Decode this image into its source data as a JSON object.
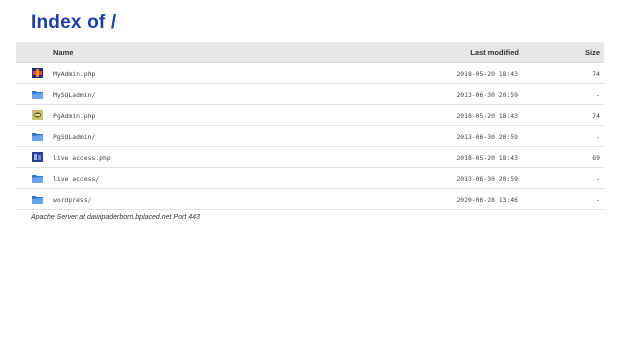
{
  "title": "Index of /",
  "headers": {
    "name": "Name",
    "modified": "Last modified",
    "size": "Size"
  },
  "rows": [
    {
      "name": "MyAdmin.php",
      "modified": "2018-05-20 18:43",
      "size": "74",
      "icon": "php-file-icon"
    },
    {
      "name": "MySQLadmin/",
      "modified": "2013-06-30 20:59",
      "size": "-",
      "icon": "folder-icon"
    },
    {
      "name": "PgAdmin.php",
      "modified": "2018-05-20 18:43",
      "size": "74",
      "icon": "php-file-icon"
    },
    {
      "name": "PgSQLadmin/",
      "modified": "2013-06-30 20:59",
      "size": "-",
      "icon": "folder-icon"
    },
    {
      "name": "live access.php",
      "modified": "2018-05-20 18:43",
      "size": "69",
      "icon": "php-file-icon"
    },
    {
      "name": "live access/",
      "modified": "2013-06-30 20:59",
      "size": "-",
      "icon": "folder-icon"
    },
    {
      "name": "wordpress/",
      "modified": "2020-06-28 13:46",
      "size": "-",
      "icon": "folder-icon"
    }
  ],
  "footer": "Apache Server at dawipaderborn.bplaced.net Port 443",
  "colors": {
    "title": "#1f3f9f",
    "header_bg": "#e7e7e7",
    "folder": "#3a78c8"
  }
}
